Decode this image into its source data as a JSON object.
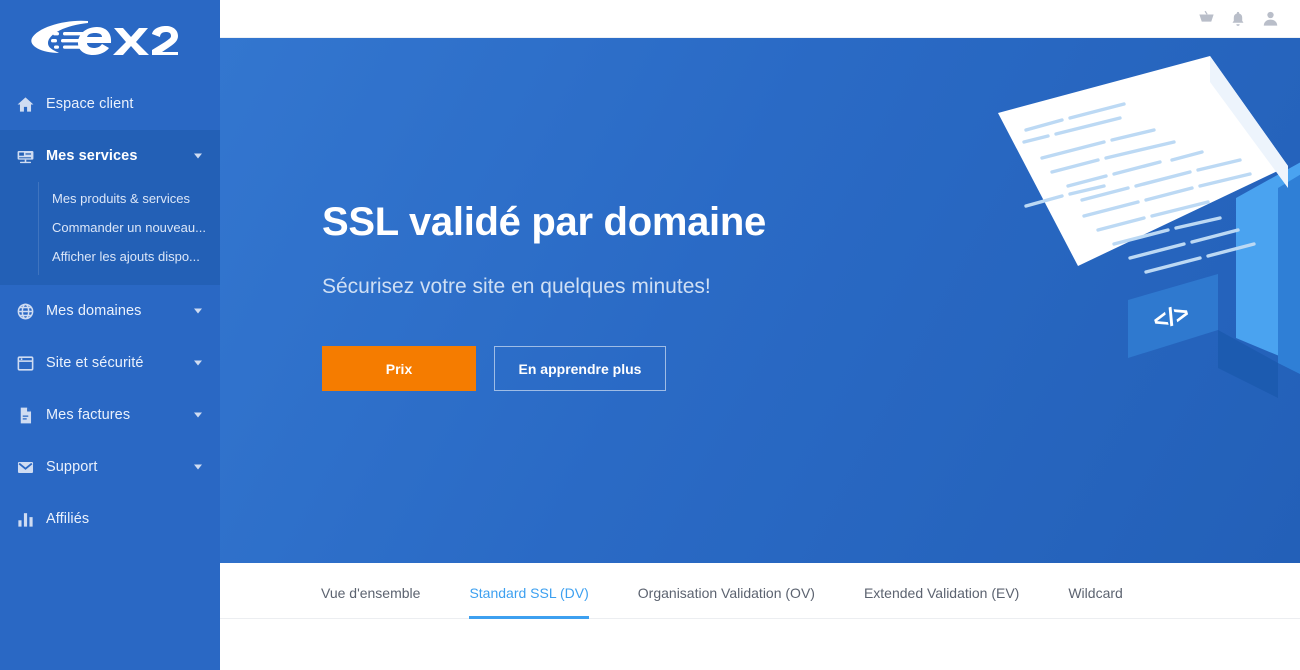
{
  "brand": {
    "logo_text": "ex2",
    "accent_blue": "#2a68c4",
    "accent_orange": "#f57c00",
    "tab_active_blue": "#3da0f0"
  },
  "topbar": {
    "icons": [
      {
        "name": "cart-icon",
        "glyph": "cart"
      },
      {
        "name": "notifications-bell-icon",
        "glyph": "bell"
      },
      {
        "name": "user-account-icon",
        "glyph": "user"
      }
    ]
  },
  "sidebar": {
    "items": [
      {
        "label": "Espace client",
        "icon": "home-icon",
        "has_caret": false,
        "active": false
      },
      {
        "label": "Mes services",
        "icon": "server-icon",
        "has_caret": true,
        "active": true
      },
      {
        "label": "Mes domaines",
        "icon": "globe-icon",
        "has_caret": true,
        "active": false
      },
      {
        "label": "Site et sécurité",
        "icon": "browser-window-icon",
        "has_caret": true,
        "active": false
      },
      {
        "label": "Mes factures",
        "icon": "document-icon",
        "has_caret": true,
        "active": false
      },
      {
        "label": "Support",
        "icon": "envelope-icon",
        "has_caret": true,
        "active": false
      },
      {
        "label": "Affiliés",
        "icon": "bar-chart-icon",
        "has_caret": false,
        "active": false
      }
    ],
    "submenu": [
      {
        "label": "Mes produits & services"
      },
      {
        "label": "Commander un nouveau..."
      },
      {
        "label": "Afficher les ajouts dispo..."
      }
    ]
  },
  "hero": {
    "title": "SSL validé par domaine",
    "subtitle": "Sécurisez votre site en quelques minutes!",
    "primary_button": "Prix",
    "secondary_button": "En apprendre plus",
    "illustration_badge": "</>"
  },
  "tabs": [
    {
      "label": "Vue d'ensemble",
      "active": false
    },
    {
      "label": "Standard SSL (DV)",
      "active": true
    },
    {
      "label": "Organisation Validation (OV)",
      "active": false
    },
    {
      "label": "Extended Validation (EV)",
      "active": false
    },
    {
      "label": "Wildcard",
      "active": false
    }
  ]
}
